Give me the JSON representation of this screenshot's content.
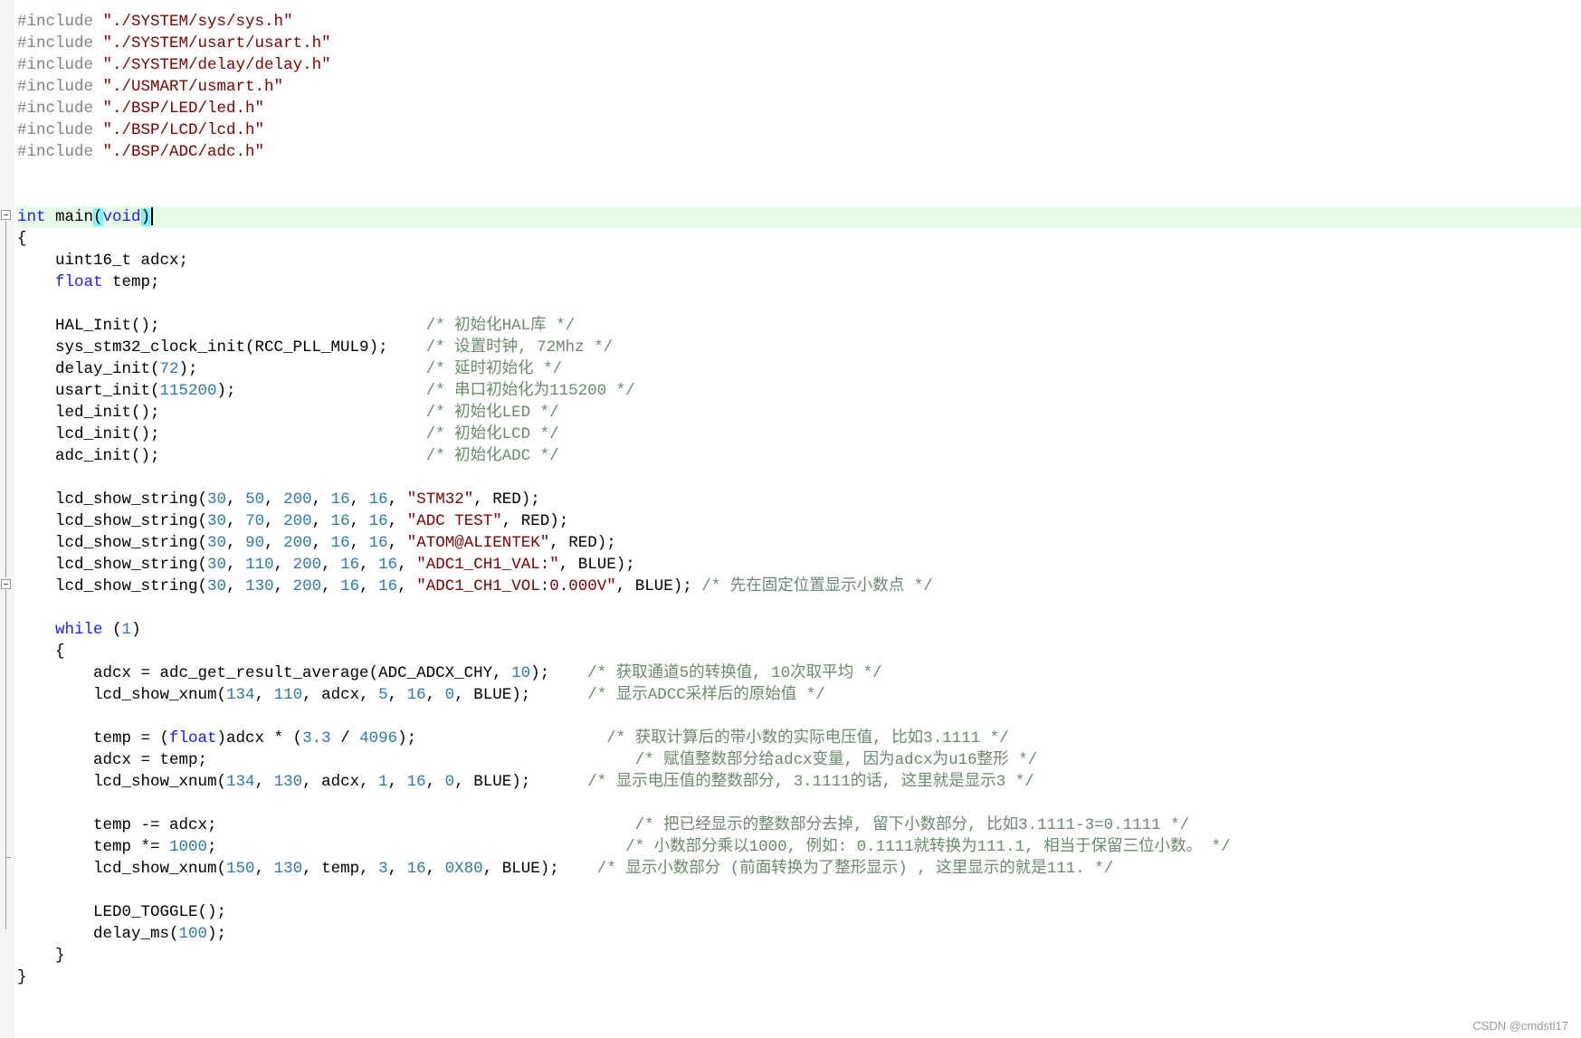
{
  "editor": {
    "lines": [
      {
        "tokens": [
          [
            "pre",
            "#include"
          ],
          [
            "",
            " "
          ],
          [
            "str",
            "\"./SYSTEM/sys/sys.h\""
          ]
        ]
      },
      {
        "tokens": [
          [
            "pre",
            "#include"
          ],
          [
            "",
            " "
          ],
          [
            "str",
            "\"./SYSTEM/usart/usart.h\""
          ]
        ]
      },
      {
        "tokens": [
          [
            "pre",
            "#include"
          ],
          [
            "",
            " "
          ],
          [
            "str",
            "\"./SYSTEM/delay/delay.h\""
          ]
        ]
      },
      {
        "tokens": [
          [
            "pre",
            "#include"
          ],
          [
            "",
            " "
          ],
          [
            "str",
            "\"./USMART/usmart.h\""
          ]
        ]
      },
      {
        "tokens": [
          [
            "pre",
            "#include"
          ],
          [
            "",
            " "
          ],
          [
            "str",
            "\"./BSP/LED/led.h\""
          ]
        ]
      },
      {
        "tokens": [
          [
            "pre",
            "#include"
          ],
          [
            "",
            " "
          ],
          [
            "str",
            "\"./BSP/LCD/lcd.h\""
          ]
        ]
      },
      {
        "tokens": [
          [
            "pre",
            "#include"
          ],
          [
            "",
            " "
          ],
          [
            "str",
            "\"./BSP/ADC/adc.h\""
          ]
        ]
      },
      {
        "tokens": []
      },
      {
        "tokens": []
      },
      {
        "current": true,
        "tokens": [
          [
            "kw",
            "int"
          ],
          [
            "",
            " main"
          ],
          [
            "brace",
            "("
          ],
          [
            "kw",
            "void"
          ],
          [
            "brace",
            ")"
          ]
        ]
      },
      {
        "tokens": [
          [
            "",
            "{"
          ]
        ]
      },
      {
        "tokens": [
          [
            "",
            "    uint16_t adcx;"
          ]
        ]
      },
      {
        "tokens": [
          [
            "",
            "    "
          ],
          [
            "kw",
            "float"
          ],
          [
            "",
            " temp;"
          ]
        ]
      },
      {
        "tokens": []
      },
      {
        "tokens": [
          [
            "",
            "    HAL_Init();                            "
          ],
          [
            "cmt",
            "/* 初始化HAL库 */"
          ]
        ]
      },
      {
        "tokens": [
          [
            "",
            "    sys_stm32_clock_init(RCC_PLL_MUL9);    "
          ],
          [
            "cmt",
            "/* 设置时钟, 72Mhz */"
          ]
        ]
      },
      {
        "tokens": [
          [
            "",
            "    delay_init("
          ],
          [
            "num",
            "72"
          ],
          [
            "",
            ");                        "
          ],
          [
            "cmt",
            "/* 延时初始化 */"
          ]
        ]
      },
      {
        "tokens": [
          [
            "",
            "    usart_init("
          ],
          [
            "num",
            "115200"
          ],
          [
            "",
            ");                    "
          ],
          [
            "cmt",
            "/* 串口初始化为115200 */"
          ]
        ]
      },
      {
        "tokens": [
          [
            "",
            "    led_init();                            "
          ],
          [
            "cmt",
            "/* 初始化LED */"
          ]
        ]
      },
      {
        "tokens": [
          [
            "",
            "    lcd_init();                            "
          ],
          [
            "cmt",
            "/* 初始化LCD */"
          ]
        ]
      },
      {
        "tokens": [
          [
            "",
            "    adc_init();                            "
          ],
          [
            "cmt",
            "/* 初始化ADC */"
          ]
        ]
      },
      {
        "tokens": []
      },
      {
        "tokens": [
          [
            "",
            "    lcd_show_string("
          ],
          [
            "num",
            "30"
          ],
          [
            "",
            ", "
          ],
          [
            "num",
            "50"
          ],
          [
            "",
            ", "
          ],
          [
            "num",
            "200"
          ],
          [
            "",
            ", "
          ],
          [
            "num",
            "16"
          ],
          [
            "",
            ", "
          ],
          [
            "num",
            "16"
          ],
          [
            "",
            ", "
          ],
          [
            "str",
            "\"STM32\""
          ],
          [
            "",
            ", RED);"
          ]
        ]
      },
      {
        "tokens": [
          [
            "",
            "    lcd_show_string("
          ],
          [
            "num",
            "30"
          ],
          [
            "",
            ", "
          ],
          [
            "num",
            "70"
          ],
          [
            "",
            ", "
          ],
          [
            "num",
            "200"
          ],
          [
            "",
            ", "
          ],
          [
            "num",
            "16"
          ],
          [
            "",
            ", "
          ],
          [
            "num",
            "16"
          ],
          [
            "",
            ", "
          ],
          [
            "str",
            "\"ADC TEST\""
          ],
          [
            "",
            ", RED);"
          ]
        ]
      },
      {
        "tokens": [
          [
            "",
            "    lcd_show_string("
          ],
          [
            "num",
            "30"
          ],
          [
            "",
            ", "
          ],
          [
            "num",
            "90"
          ],
          [
            "",
            ", "
          ],
          [
            "num",
            "200"
          ],
          [
            "",
            ", "
          ],
          [
            "num",
            "16"
          ],
          [
            "",
            ", "
          ],
          [
            "num",
            "16"
          ],
          [
            "",
            ", "
          ],
          [
            "str",
            "\"ATOM@ALIENTEK\""
          ],
          [
            "",
            ", RED);"
          ]
        ]
      },
      {
        "tokens": [
          [
            "",
            "    lcd_show_string("
          ],
          [
            "num",
            "30"
          ],
          [
            "",
            ", "
          ],
          [
            "num",
            "110"
          ],
          [
            "",
            ", "
          ],
          [
            "num",
            "200"
          ],
          [
            "",
            ", "
          ],
          [
            "num",
            "16"
          ],
          [
            "",
            ", "
          ],
          [
            "num",
            "16"
          ],
          [
            "",
            ", "
          ],
          [
            "str",
            "\"ADC1_CH1_VAL:\""
          ],
          [
            "",
            ", BLUE);"
          ]
        ]
      },
      {
        "tokens": [
          [
            "",
            "    lcd_show_string("
          ],
          [
            "num",
            "30"
          ],
          [
            "",
            ", "
          ],
          [
            "num",
            "130"
          ],
          [
            "",
            ", "
          ],
          [
            "num",
            "200"
          ],
          [
            "",
            ", "
          ],
          [
            "num",
            "16"
          ],
          [
            "",
            ", "
          ],
          [
            "num",
            "16"
          ],
          [
            "",
            ", "
          ],
          [
            "str",
            "\"ADC1_CH1_VOL:0.000V\""
          ],
          [
            "",
            ", BLUE); "
          ],
          [
            "cmt",
            "/* 先在固定位置显示小数点 */"
          ]
        ]
      },
      {
        "tokens": []
      },
      {
        "tokens": [
          [
            "",
            "    "
          ],
          [
            "kw",
            "while"
          ],
          [
            "",
            " ("
          ],
          [
            "num",
            "1"
          ],
          [
            "",
            ")"
          ]
        ]
      },
      {
        "tokens": [
          [
            "",
            "    {"
          ]
        ]
      },
      {
        "tokens": [
          [
            "",
            "        adcx = adc_get_result_average(ADC_ADCX_CHY, "
          ],
          [
            "num",
            "10"
          ],
          [
            "",
            ");    "
          ],
          [
            "cmt",
            "/* 获取通道5的转换值, 10次取平均 */"
          ]
        ]
      },
      {
        "tokens": [
          [
            "",
            "        lcd_show_xnum("
          ],
          [
            "num",
            "134"
          ],
          [
            "",
            ", "
          ],
          [
            "num",
            "110"
          ],
          [
            "",
            ", adcx, "
          ],
          [
            "num",
            "5"
          ],
          [
            "",
            ", "
          ],
          [
            "num",
            "16"
          ],
          [
            "",
            ", "
          ],
          [
            "num",
            "0"
          ],
          [
            "",
            ", BLUE);      "
          ],
          [
            "cmt",
            "/* 显示ADCC采样后的原始值 */"
          ]
        ]
      },
      {
        "tokens": []
      },
      {
        "tokens": [
          [
            "",
            "        temp = ("
          ],
          [
            "kw",
            "float"
          ],
          [
            "",
            ")adcx * ("
          ],
          [
            "num",
            "3.3"
          ],
          [
            "",
            " / "
          ],
          [
            "num",
            "4096"
          ],
          [
            "",
            ");                    "
          ],
          [
            "cmt",
            "/* 获取计算后的带小数的实际电压值, 比如3.1111 */"
          ]
        ]
      },
      {
        "tokens": [
          [
            "",
            "        adcx = temp;                                             "
          ],
          [
            "cmt",
            "/* 赋值整数部分给adcx变量, 因为adcx为u16整形 */"
          ]
        ]
      },
      {
        "tokens": [
          [
            "",
            "        lcd_show_xnum("
          ],
          [
            "num",
            "134"
          ],
          [
            "",
            ", "
          ],
          [
            "num",
            "130"
          ],
          [
            "",
            ", adcx, "
          ],
          [
            "num",
            "1"
          ],
          [
            "",
            ", "
          ],
          [
            "num",
            "16"
          ],
          [
            "",
            ", "
          ],
          [
            "num",
            "0"
          ],
          [
            "",
            ", BLUE);      "
          ],
          [
            "cmt",
            "/* 显示电压值的整数部分, 3.1111的话, 这里就是显示3 */"
          ]
        ]
      },
      {
        "tokens": []
      },
      {
        "tokens": [
          [
            "",
            "        temp -= adcx;                                            "
          ],
          [
            "cmt",
            "/* 把已经显示的整数部分去掉, 留下小数部分, 比如3.1111-3=0.1111 */"
          ]
        ]
      },
      {
        "tokens": [
          [
            "",
            "        temp *= "
          ],
          [
            "num",
            "1000"
          ],
          [
            "",
            ";                                           "
          ],
          [
            "cmt",
            "/* 小数部分乘以1000, 例如: 0.1111就转换为111.1, 相当于保留三位小数。 */"
          ]
        ]
      },
      {
        "tokens": [
          [
            "",
            "        lcd_show_xnum("
          ],
          [
            "num",
            "150"
          ],
          [
            "",
            ", "
          ],
          [
            "num",
            "130"
          ],
          [
            "",
            ", temp, "
          ],
          [
            "num",
            "3"
          ],
          [
            "",
            ", "
          ],
          [
            "num",
            "16"
          ],
          [
            "",
            ", "
          ],
          [
            "num",
            "0X80"
          ],
          [
            "",
            ", BLUE);    "
          ],
          [
            "cmt",
            "/* 显示小数部分 (前面转换为了整形显示) , 这里显示的就是111. */"
          ]
        ]
      },
      {
        "tokens": []
      },
      {
        "tokens": [
          [
            "",
            "        LED0_TOGGLE();"
          ]
        ]
      },
      {
        "tokens": [
          [
            "",
            "        delay_ms("
          ],
          [
            "num",
            "100"
          ],
          [
            "",
            ");"
          ]
        ]
      },
      {
        "tokens": [
          [
            "",
            "    }"
          ]
        ]
      },
      {
        "tokens": [
          [
            "",
            "}"
          ]
        ]
      }
    ]
  },
  "watermark": "CSDN @cmdstl17",
  "colors": {
    "preprocessor": "#808080",
    "keyword": "#1a1aff",
    "number": "#2b7ba8",
    "string": "#800000",
    "comment": "#6a8a6a",
    "current_line": "#e6fbe6",
    "brace_match": "#7ff0ff"
  }
}
